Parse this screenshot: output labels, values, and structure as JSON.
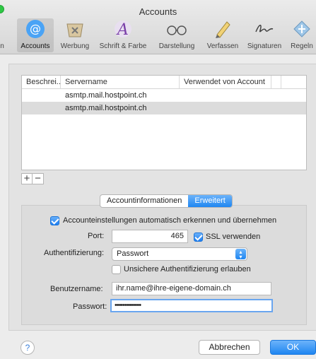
{
  "window": {
    "title": "Accounts"
  },
  "toolbar": {
    "items": [
      {
        "label": "n",
        "icon": "general-icon"
      },
      {
        "label": "Accounts",
        "icon": "at-sign-icon"
      },
      {
        "label": "Werbung",
        "icon": "junk-mail-icon"
      },
      {
        "label": "Schrift & Farbe",
        "icon": "fonts-colors-icon"
      },
      {
        "label": "Darstellung",
        "icon": "viewing-glasses-icon"
      },
      {
        "label": "Verfassen",
        "icon": "composing-pencil-icon"
      },
      {
        "label": "Signaturen",
        "icon": "signature-icon"
      },
      {
        "label": "Regeln",
        "icon": "rules-icon"
      }
    ]
  },
  "table": {
    "columns": [
      "Beschrei...",
      "Servername",
      "Verwendet von Account"
    ],
    "rows": [
      {
        "description": "",
        "server": "asmtp.mail.hostpoint.ch",
        "used_by": ""
      },
      {
        "description": "",
        "server": "asmtp.mail.hostpoint.ch",
        "used_by": ""
      }
    ]
  },
  "tabs": {
    "info": "Accountinformationen",
    "advanced": "Erweitert"
  },
  "form": {
    "auto_detect": "Accounteinstellungen automatisch erkennen und übernehmen",
    "port_label": "Port:",
    "port_value": "465",
    "ssl_label": "SSL verwenden",
    "auth_label": "Authentifizierung:",
    "auth_value": "Passwort",
    "insecure_label": "Unsichere Authentifizierung erlauben",
    "username_label": "Benutzername:",
    "username_value": "ihr.name@ihre-eigene-domain.ch",
    "password_label": "Passwort:",
    "password_value": "•••••••••••••"
  },
  "buttons": {
    "help": "?",
    "cancel": "Abbrechen",
    "ok": "OK"
  },
  "colors": {
    "accent": "#1f86f1",
    "selected_row": "#dcdcdc"
  }
}
